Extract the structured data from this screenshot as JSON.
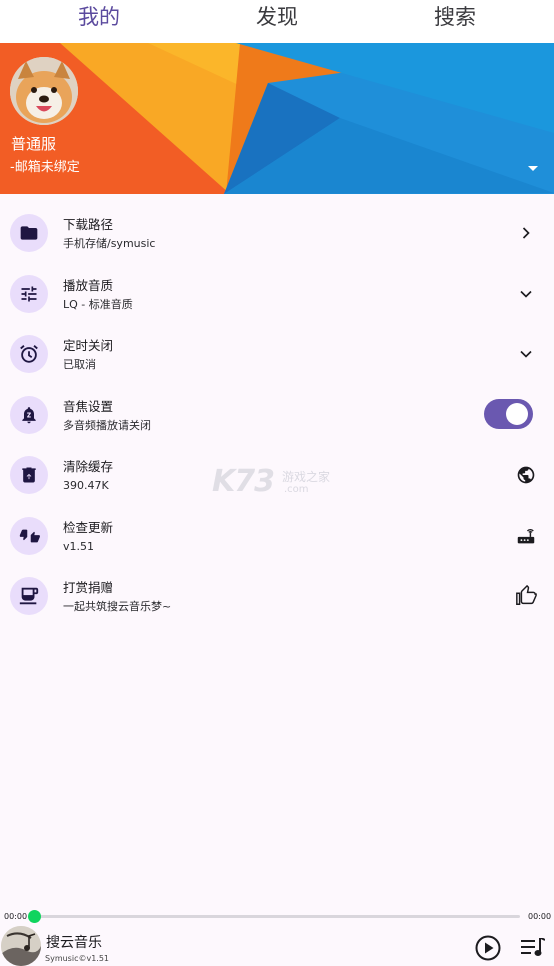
{
  "tabs": [
    {
      "label": "我的",
      "active": true
    },
    {
      "label": "发现",
      "active": false
    },
    {
      "label": "搜索",
      "active": false
    }
  ],
  "profile": {
    "name": "普通服",
    "email": "-邮箱未绑定"
  },
  "settings": [
    {
      "title": "下载路径",
      "subtitle": "手机存储/symusic",
      "icon": "folder-icon",
      "trailing": "chevron-right-icon"
    },
    {
      "title": "播放音质",
      "subtitle": "LQ - 标准音质",
      "icon": "tune-icon",
      "trailing": "chevron-down-icon"
    },
    {
      "title": "定时关闭",
      "subtitle": "已取消",
      "icon": "alarm-icon",
      "trailing": "chevron-down-icon"
    },
    {
      "title": "音焦设置",
      "subtitle": "多音频播放请关闭",
      "icon": "notification-sleep-icon",
      "trailing": "toggle",
      "toggle_on": true
    },
    {
      "title": "清除缓存",
      "subtitle": "390.47K",
      "icon": "delete-icon",
      "trailing": "globe-icon"
    },
    {
      "title": "检查更新",
      "subtitle": "v1.51",
      "icon": "thumbs-up-down-icon",
      "trailing": "router-icon"
    },
    {
      "title": "打赏捐赠",
      "subtitle": "一起共筑搜云音乐梦~",
      "icon": "coffee-icon",
      "trailing": "thumb-up-icon"
    }
  ],
  "watermark": {
    "brand": "K73",
    "site": "游戏之家",
    "url": ".com"
  },
  "player": {
    "current_time": "00:00",
    "total_time": "00:00",
    "progress": 0,
    "title": "搜云音乐",
    "subtitle": "Symusic©v1.51"
  },
  "colors": {
    "accent": "#5b4a9e",
    "icon_bg": "#e9ddfb",
    "toggle": "#6a58b0",
    "progress": "#10d45e",
    "banner_orange": "#f25d25",
    "banner_yellow": "#f9a825",
    "banner_blue": "#1f8fd9"
  }
}
